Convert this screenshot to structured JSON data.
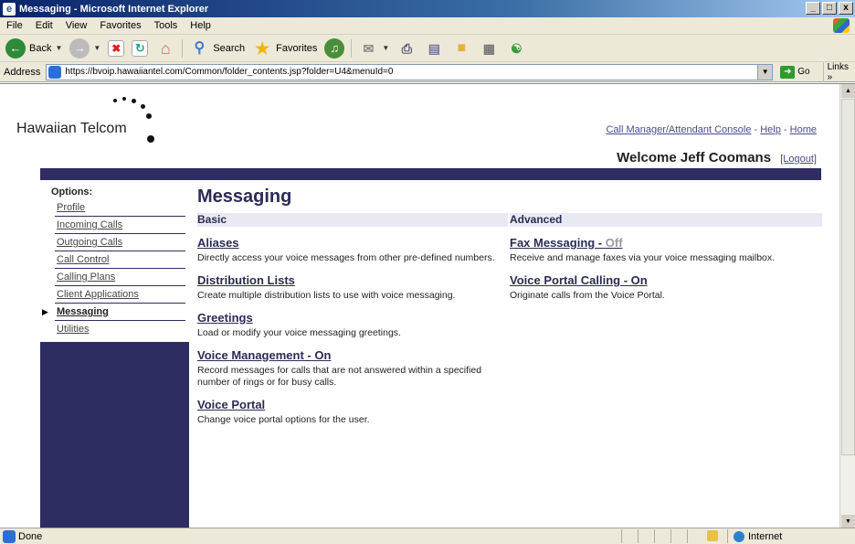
{
  "window": {
    "title": "Messaging - Microsoft Internet Explorer",
    "controls": [
      "_",
      "□",
      "x"
    ]
  },
  "menu": [
    "File",
    "Edit",
    "View",
    "Favorites",
    "Tools",
    "Help"
  ],
  "toolbar": {
    "back": "Back",
    "search": "Search",
    "favorites": "Favorites"
  },
  "address": {
    "label": "Address",
    "url": "https://bvoip.hawaiiantel.com/Common/folder_contents.jsp?folder=U4&menuId=0",
    "go": "Go",
    "links": "Links »"
  },
  "header": {
    "logo": "Hawaiian Telcom",
    "links": [
      "Call Manager/Attendant Console",
      "Help",
      "Home"
    ],
    "separator": "-",
    "welcome": "Welcome Jeff Coomans",
    "logout": "[Logout]"
  },
  "sidebar": {
    "title": "Options:",
    "items": [
      {
        "label": "Profile"
      },
      {
        "label": "Incoming Calls"
      },
      {
        "label": "Outgoing Calls"
      },
      {
        "label": "Call Control"
      },
      {
        "label": "Calling Plans"
      },
      {
        "label": "Client Applications"
      },
      {
        "label": "Messaging"
      },
      {
        "label": "Utilities"
      }
    ],
    "active": "Messaging"
  },
  "main": {
    "title": "Messaging",
    "basic": {
      "heading": "Basic",
      "items": [
        {
          "title": "Aliases",
          "desc": "Directly access your voice messages from other pre-defined numbers."
        },
        {
          "title": "Distribution Lists",
          "desc": "Create multiple distribution lists to use with voice messaging."
        },
        {
          "title": "Greetings",
          "desc": "Load or modify your voice messaging greetings."
        },
        {
          "title": "Voice Management - On",
          "desc": "Record messages for calls that are not answered within a specified number of rings or for busy calls."
        },
        {
          "title": "Voice Portal",
          "desc": "Change voice portal options for the user."
        }
      ]
    },
    "advanced": {
      "heading": "Advanced",
      "items": [
        {
          "title": "Fax Messaging - ",
          "status": "Off",
          "desc": "Receive and manage faxes via your voice messaging mailbox."
        },
        {
          "title": "Voice Portal Calling - On",
          "desc": "Originate calls from the Voice Portal."
        }
      ]
    }
  },
  "status": {
    "text": "Done",
    "zone": "Internet"
  },
  "colors": {
    "nav_bar": "#2d2d62",
    "heading": "#2b2b55",
    "section_head_bg": "#e9e9f4",
    "status_off": "#9a9a9a"
  }
}
